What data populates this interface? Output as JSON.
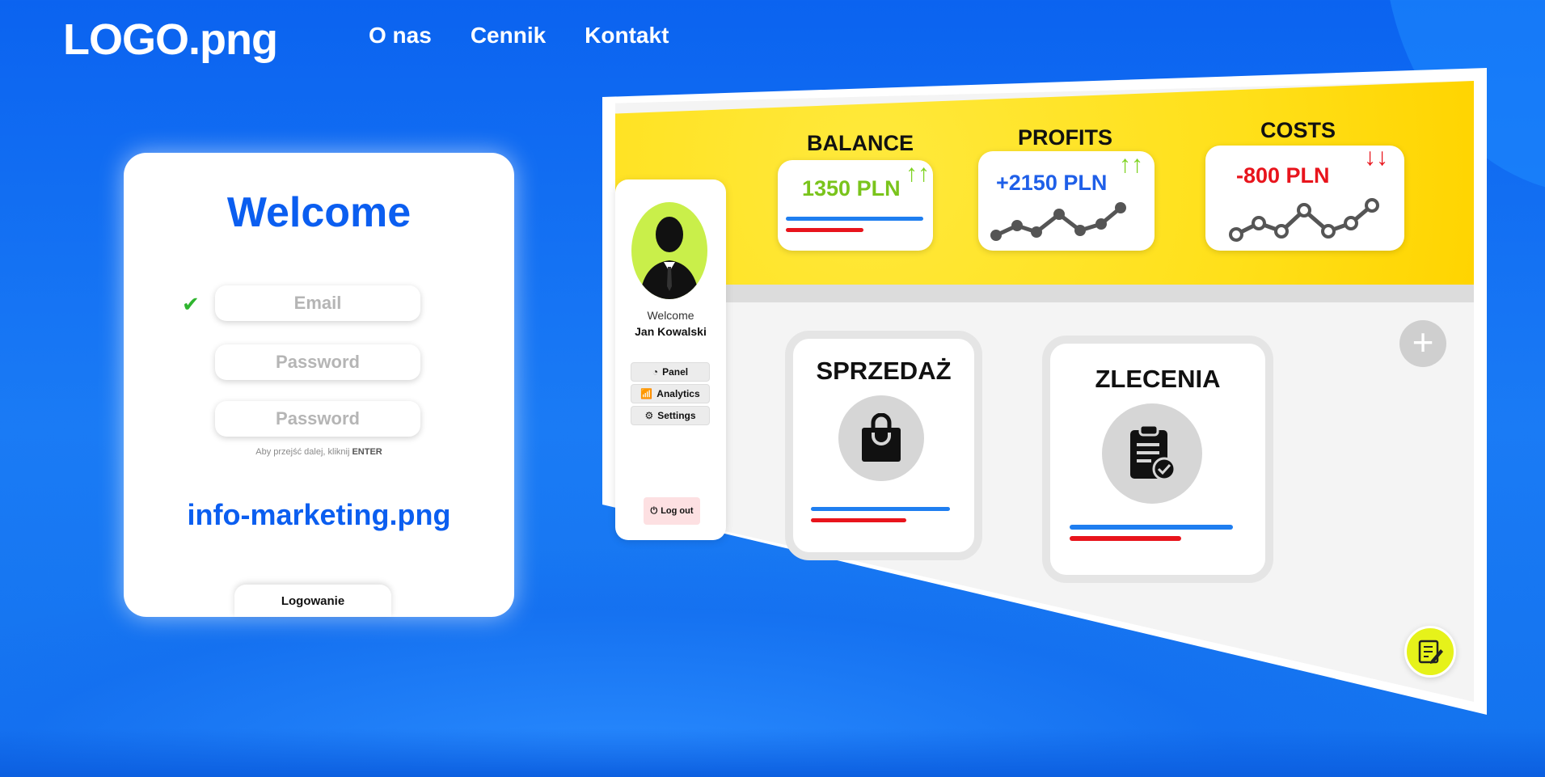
{
  "header": {
    "logo": "LOGO.png",
    "nav": [
      "O nas",
      "Cennik",
      "Kontakt"
    ]
  },
  "login": {
    "welcome": "Welcome",
    "email_placeholder": "Email",
    "password_placeholder": "Password",
    "password2_placeholder": "Password",
    "hint_prefix": "Aby przejść dalej, kliknij",
    "hint_key": "ENTER",
    "info": "info-marketing.png",
    "tab_label": "Logowanie"
  },
  "dashboard": {
    "balance": {
      "title": "BALANCE",
      "value": "1350 PLN",
      "color": "#7ac41c"
    },
    "profits": {
      "title": "PROFITS",
      "value": "+2150 PLN",
      "color": "#1f5fe8"
    },
    "costs": {
      "title": "COSTS",
      "value": "-800 PLN",
      "color": "#e8141c"
    },
    "user": {
      "welcome": "Welcome",
      "name": "Jan Kowalski"
    },
    "menu": [
      "Panel",
      "Analytics",
      "Settings"
    ],
    "logout": "Log out",
    "tiles": [
      "SPRZEDAŻ",
      "ZLECENIA"
    ],
    "add_symbol": "+"
  },
  "colors": {
    "brand_blue": "#0b5ef0",
    "yellow": "#ffe01a",
    "up_green": "#7ed321",
    "down_red": "#e8141c"
  }
}
